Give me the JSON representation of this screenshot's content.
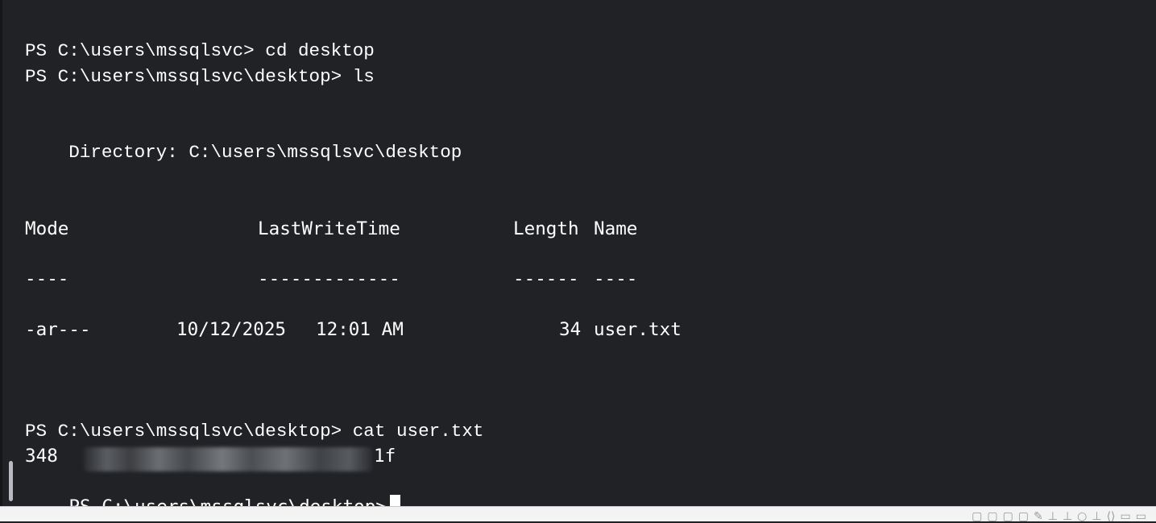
{
  "terminal": {
    "lines": {
      "l1": "PS C:\\users\\mssqlsvc> cd desktop",
      "l2": "PS C:\\users\\mssqlsvc\\desktop> ls",
      "directory": "    Directory: C:\\users\\mssqlsvc\\desktop",
      "headers": {
        "mode": "Mode",
        "lastwrite": "LastWriteTime",
        "length": "Length",
        "name": "Name"
      },
      "dashes": {
        "mode": "----",
        "lastwrite": "-------------",
        "length": "------",
        "name": "----"
      },
      "file": {
        "mode": "-ar---",
        "date": "10/12/2025",
        "time": "12:01 AM",
        "length": "34",
        "name": "user.txt"
      },
      "l_cat": "PS C:\\users\\mssqlsvc\\desktop> cat user.txt",
      "flag_start": "348",
      "flag_end": "1f",
      "prompt": "PS C:\\users\\mssqlsvc\\desktop>"
    }
  },
  "status_bar": {
    "icons": [
      "window-icon",
      "window-icon",
      "window-icon",
      "window-icon",
      "tool-icon",
      "tool-icon",
      "tool-icon",
      "circle-icon",
      "tool-icon",
      "brackets-icon",
      "panel-icon",
      "panel-icon"
    ]
  }
}
